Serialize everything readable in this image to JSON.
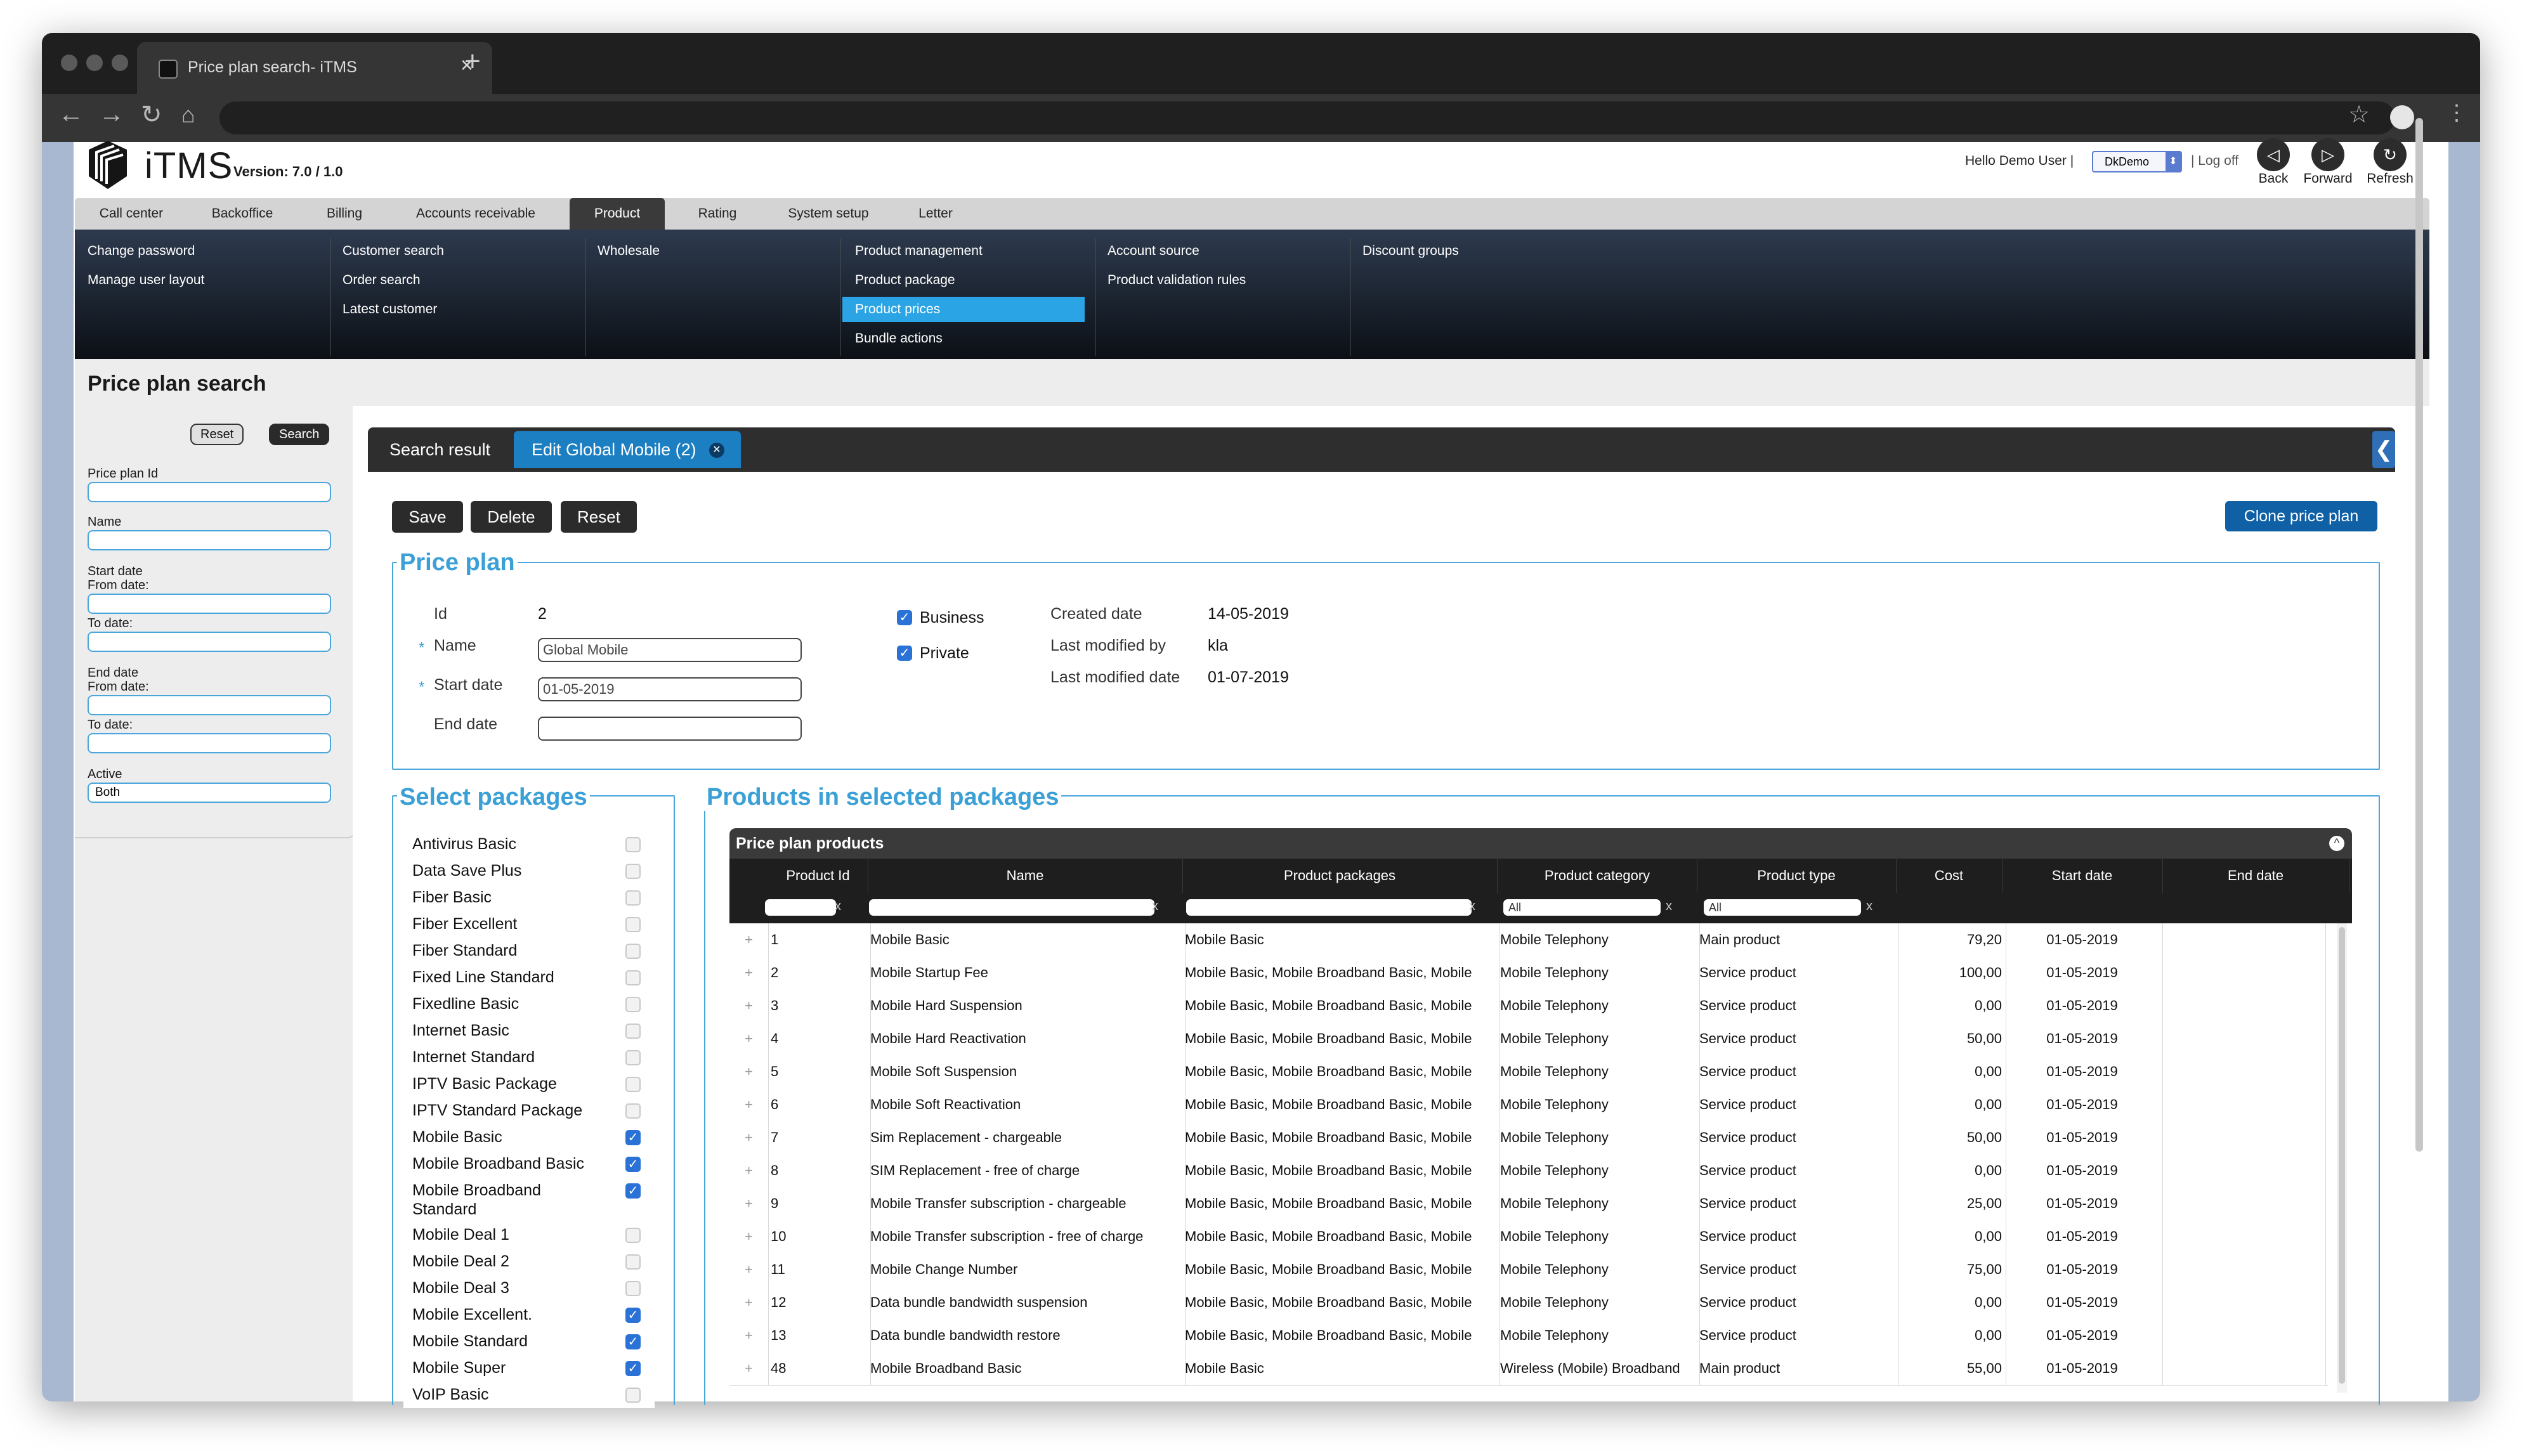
{
  "browser": {
    "tab_title": "Price plan search- iTMS",
    "tab_close": "×",
    "new_tab": "+"
  },
  "header": {
    "brand": "iTMS",
    "version": "Version: 7.0 / 1.0",
    "greeting": "Hello Demo User |",
    "tenant": "DkDemo",
    "logoff": "| Log off",
    "back": "Back",
    "forward": "Forward",
    "refresh": "Refresh"
  },
  "menu": {
    "items": [
      "Call center",
      "Backoffice",
      "Billing",
      "Accounts receivable",
      "Product",
      "Rating",
      "System setup",
      "Letter"
    ],
    "active_index": 4,
    "columns": [
      [
        "Change password",
        "Manage user layout"
      ],
      [
        "Customer search",
        "Order search",
        "Latest customer"
      ],
      [
        "Wholesale"
      ],
      [
        "Product management",
        "Product package",
        "Product prices",
        "Bundle actions"
      ],
      [
        "Account source",
        "Product validation rules"
      ],
      [
        "Discount groups"
      ]
    ],
    "selected": "Product prices"
  },
  "page": {
    "title": "Price plan search"
  },
  "left_panel": {
    "reset": "Reset",
    "search": "Search",
    "price_plan_id": "Price plan Id",
    "name": "Name",
    "start_date": "Start date",
    "start_from": "From date:",
    "start_to": "To date:",
    "end_date": "End date",
    "end_from": "From date:",
    "end_to": "To date:",
    "active": "Active",
    "active_value": "Both"
  },
  "tabs": {
    "search_result": "Search result",
    "edit": "Edit Global Mobile (2)",
    "collapse": "❮"
  },
  "actions": {
    "save": "Save",
    "delete": "Delete",
    "reset": "Reset",
    "clone": "Clone price plan"
  },
  "price_plan": {
    "legend": "Price plan",
    "star": "*",
    "id_label": "Id",
    "id_value": "2",
    "name_label": "Name",
    "name_value": "Global Mobile",
    "start_label": "Start date",
    "start_value": "01-05-2019",
    "end_label": "End date",
    "end_value": "",
    "business": "Business",
    "private": "Private",
    "created_label": "Created date",
    "created_value": "14-05-2019",
    "modified_by_label": "Last modified by",
    "modified_by_value": "kla",
    "modified_date_label": "Last modified date",
    "modified_date_value": "01-07-2019"
  },
  "packages": {
    "legend": "Select packages",
    "items": [
      {
        "name": "Antivirus Basic",
        "checked": false
      },
      {
        "name": "Data Save Plus",
        "checked": false
      },
      {
        "name": "Fiber Basic",
        "checked": false
      },
      {
        "name": "Fiber Excellent",
        "checked": false
      },
      {
        "name": "Fiber Standard",
        "checked": false
      },
      {
        "name": "Fixed Line Standard",
        "checked": false
      },
      {
        "name": "Fixedline Basic",
        "checked": false
      },
      {
        "name": "Internet Basic",
        "checked": false
      },
      {
        "name": "Internet Standard",
        "checked": false
      },
      {
        "name": "IPTV Basic Package",
        "checked": false
      },
      {
        "name": "IPTV Standard Package",
        "checked": false
      },
      {
        "name": "Mobile Basic",
        "checked": true
      },
      {
        "name": "Mobile Broadband Basic",
        "checked": true
      },
      {
        "name": "Mobile Broadband Standard",
        "checked": true
      },
      {
        "name": "Mobile Deal 1",
        "checked": false
      },
      {
        "name": "Mobile Deal 2",
        "checked": false
      },
      {
        "name": "Mobile Deal 3",
        "checked": false
      },
      {
        "name": "Mobile Excellent.",
        "checked": true
      },
      {
        "name": "Mobile Standard",
        "checked": true
      },
      {
        "name": "Mobile Super",
        "checked": true
      },
      {
        "name": "VoIP Basic",
        "checked": false
      }
    ]
  },
  "products": {
    "legend": "Products in selected packages",
    "grid_title": "Price plan products",
    "columns": [
      "Product Id",
      "Name",
      "Product packages",
      "Product category",
      "Product type",
      "Cost",
      "Start date",
      "End date"
    ],
    "filter_all": "All",
    "filter_x": "x",
    "rows": [
      {
        "id": "1",
        "name": "Mobile Basic",
        "packages": "Mobile Basic",
        "category": "Mobile Telephony",
        "type": "Main product",
        "cost": "79,20",
        "start": "01-05-2019",
        "end": ""
      },
      {
        "id": "2",
        "name": "Mobile Startup Fee",
        "packages": "Mobile Basic, Mobile Broadband Basic, Mobile",
        "category": "Mobile Telephony",
        "type": "Service product",
        "cost": "100,00",
        "start": "01-05-2019",
        "end": ""
      },
      {
        "id": "3",
        "name": "Mobile Hard Suspension",
        "packages": "Mobile Basic, Mobile Broadband Basic, Mobile",
        "category": "Mobile Telephony",
        "type": "Service product",
        "cost": "0,00",
        "start": "01-05-2019",
        "end": ""
      },
      {
        "id": "4",
        "name": "Mobile Hard Reactivation",
        "packages": "Mobile Basic, Mobile Broadband Basic, Mobile",
        "category": "Mobile Telephony",
        "type": "Service product",
        "cost": "50,00",
        "start": "01-05-2019",
        "end": ""
      },
      {
        "id": "5",
        "name": "Mobile Soft Suspension",
        "packages": "Mobile Basic, Mobile Broadband Basic, Mobile",
        "category": "Mobile Telephony",
        "type": "Service product",
        "cost": "0,00",
        "start": "01-05-2019",
        "end": ""
      },
      {
        "id": "6",
        "name": "Mobile Soft Reactivation",
        "packages": "Mobile Basic, Mobile Broadband Basic, Mobile",
        "category": "Mobile Telephony",
        "type": "Service product",
        "cost": "0,00",
        "start": "01-05-2019",
        "end": ""
      },
      {
        "id": "7",
        "name": "Sim Replacement - chargeable",
        "packages": "Mobile Basic, Mobile Broadband Basic, Mobile",
        "category": "Mobile Telephony",
        "type": "Service product",
        "cost": "50,00",
        "start": "01-05-2019",
        "end": ""
      },
      {
        "id": "8",
        "name": "SIM Replacement - free of charge",
        "packages": "Mobile Basic, Mobile Broadband Basic, Mobile",
        "category": "Mobile Telephony",
        "type": "Service product",
        "cost": "0,00",
        "start": "01-05-2019",
        "end": ""
      },
      {
        "id": "9",
        "name": "Mobile Transfer subscription - chargeable",
        "packages": "Mobile Basic, Mobile Broadband Basic, Mobile",
        "category": "Mobile Telephony",
        "type": "Service product",
        "cost": "25,00",
        "start": "01-05-2019",
        "end": ""
      },
      {
        "id": "10",
        "name": "Mobile Transfer subscription - free of charge",
        "packages": "Mobile Basic, Mobile Broadband Basic, Mobile",
        "category": "Mobile Telephony",
        "type": "Service product",
        "cost": "0,00",
        "start": "01-05-2019",
        "end": ""
      },
      {
        "id": "11",
        "name": "Mobile Change Number",
        "packages": "Mobile Basic, Mobile Broadband Basic, Mobile",
        "category": "Mobile Telephony",
        "type": "Service product",
        "cost": "75,00",
        "start": "01-05-2019",
        "end": ""
      },
      {
        "id": "12",
        "name": "Data bundle bandwidth suspension",
        "packages": "Mobile Basic, Mobile Broadband Basic, Mobile",
        "category": "Mobile Telephony",
        "type": "Service product",
        "cost": "0,00",
        "start": "01-05-2019",
        "end": ""
      },
      {
        "id": "13",
        "name": "Data bundle bandwidth restore",
        "packages": "Mobile Basic, Mobile Broadband Basic, Mobile",
        "category": "Mobile Telephony",
        "type": "Service product",
        "cost": "0,00",
        "start": "01-05-2019",
        "end": ""
      },
      {
        "id": "48",
        "name": "Mobile Broadband Basic",
        "packages": "Mobile Basic",
        "category": "Wireless (Mobile) Broadband",
        "type": "Main product",
        "cost": "55,00",
        "start": "01-05-2019",
        "end": ""
      }
    ]
  }
}
